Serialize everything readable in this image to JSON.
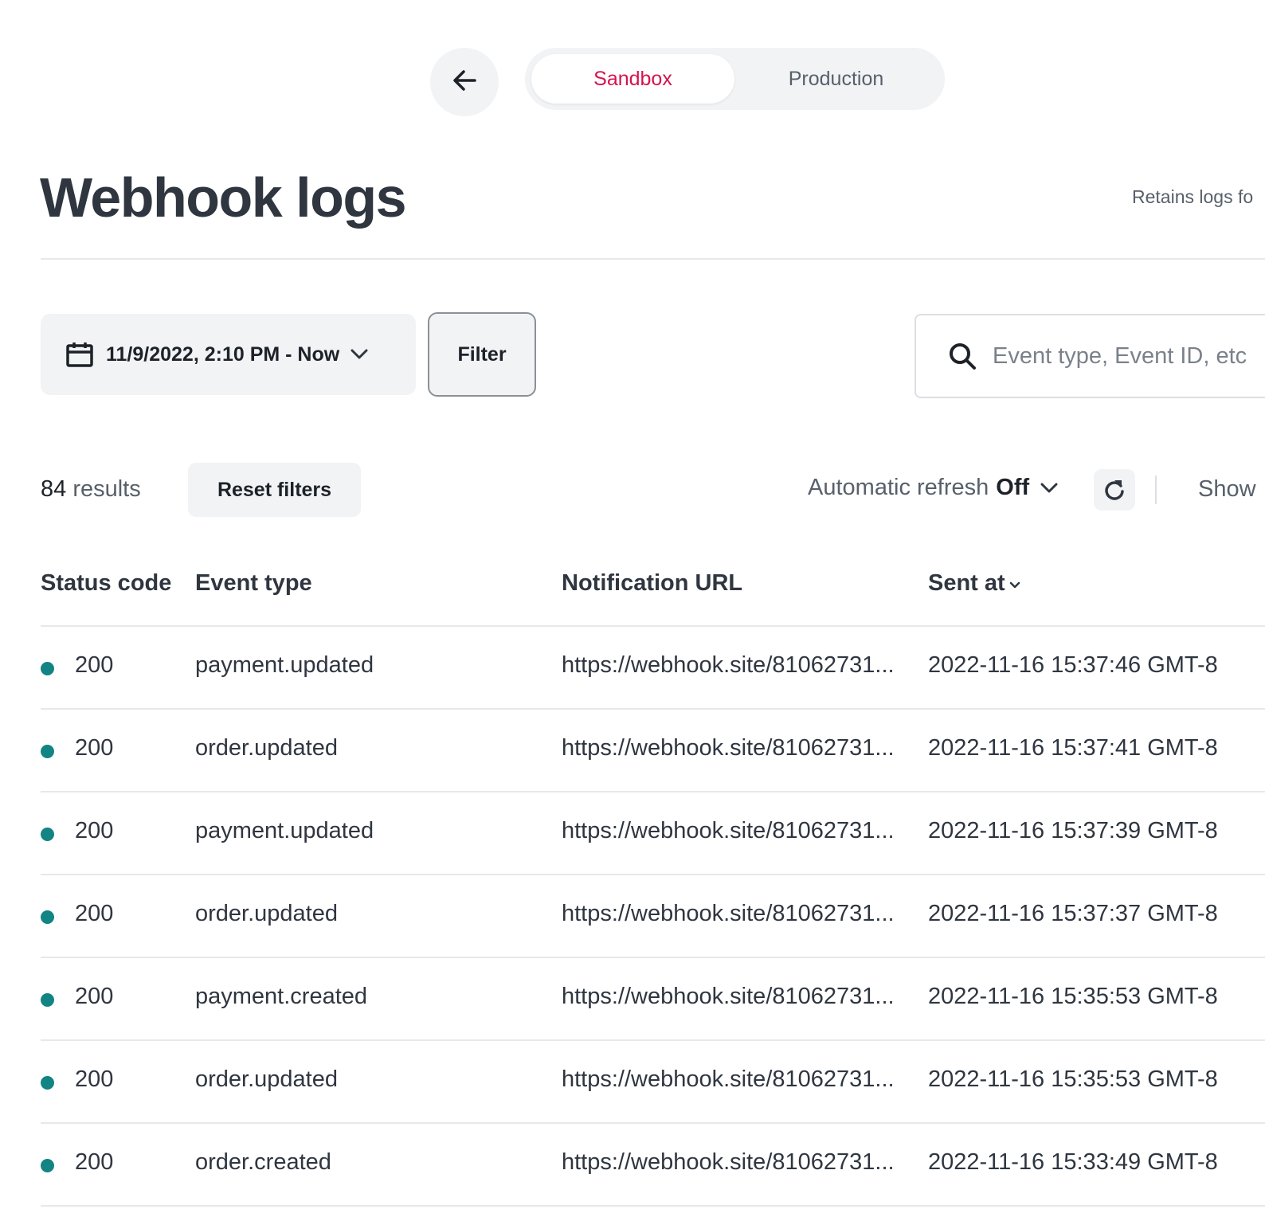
{
  "env_switcher": {
    "tabs": [
      {
        "label": "Sandbox",
        "active": true
      },
      {
        "label": "Production",
        "active": false
      }
    ]
  },
  "header": {
    "title": "Webhook logs",
    "retention_note": "Retains logs fo"
  },
  "filters": {
    "date_range": "11/9/2022, 2:10 PM - Now",
    "filter_label": "Filter",
    "search_placeholder": "Event type, Event ID, etc"
  },
  "results": {
    "count": "84",
    "count_suffix": "results",
    "reset_label": "Reset filters",
    "auto_refresh_label": "Automatic refresh",
    "auto_refresh_value": "Off",
    "show_label": "Show"
  },
  "table": {
    "columns": [
      "Status code",
      "Event type",
      "Notification URL",
      "Sent at"
    ],
    "rows": [
      {
        "status": "200",
        "event_type": "payment.updated",
        "url": "https://webhook.site/81062731...",
        "sent_at": "2022-11-16 15:37:46 GMT-8"
      },
      {
        "status": "200",
        "event_type": "order.updated",
        "url": "https://webhook.site/81062731...",
        "sent_at": "2022-11-16 15:37:41 GMT-8"
      },
      {
        "status": "200",
        "event_type": "payment.updated",
        "url": "https://webhook.site/81062731...",
        "sent_at": "2022-11-16 15:37:39 GMT-8"
      },
      {
        "status": "200",
        "event_type": "order.updated",
        "url": "https://webhook.site/81062731...",
        "sent_at": "2022-11-16 15:37:37 GMT-8"
      },
      {
        "status": "200",
        "event_type": "payment.created",
        "url": "https://webhook.site/81062731...",
        "sent_at": "2022-11-16 15:35:53 GMT-8"
      },
      {
        "status": "200",
        "event_type": "order.updated",
        "url": "https://webhook.site/81062731...",
        "sent_at": "2022-11-16 15:35:53 GMT-8"
      },
      {
        "status": "200",
        "event_type": "order.created",
        "url": "https://webhook.site/81062731...",
        "sent_at": "2022-11-16 15:33:49 GMT-8"
      }
    ]
  },
  "colors": {
    "accent": "#d6134f",
    "success": "#138484",
    "text": "#2f3640",
    "muted": "#57606b",
    "surface": "#f2f3f5"
  }
}
